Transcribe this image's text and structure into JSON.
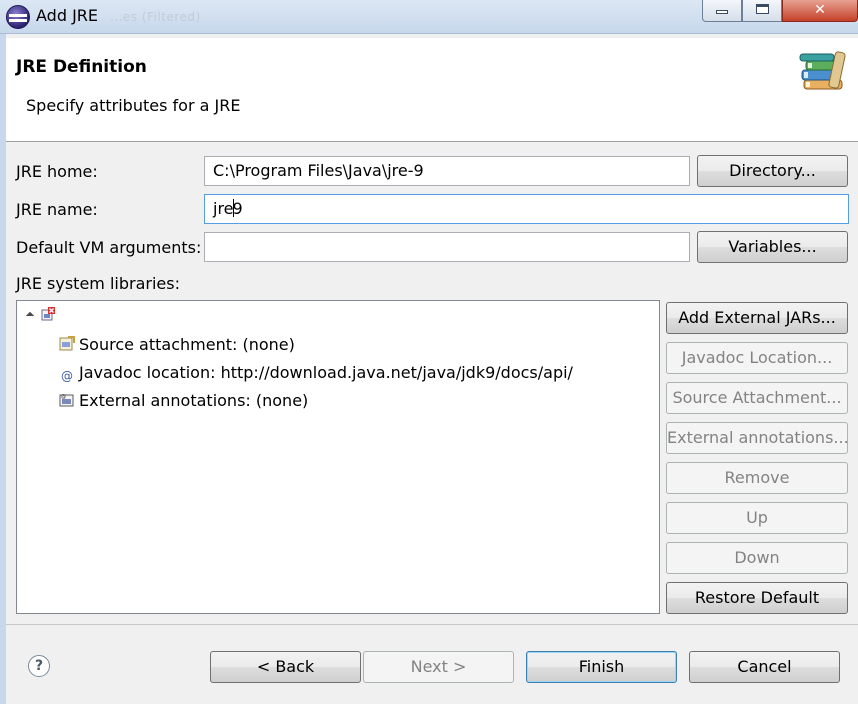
{
  "window": {
    "title": "Add JRE",
    "ghost_title": "...es (Filtered)"
  },
  "header": {
    "title": "JRE Definition",
    "description": "Specify attributes for a JRE",
    "icon": "library-books-icon"
  },
  "form": {
    "jre_home_label": "JRE home:",
    "jre_home_value": "C:\\Program Files\\Java\\jre-9",
    "jre_name_label": "JRE name:",
    "jre_name_before_caret": "jre",
    "jre_name_after_caret": "9",
    "vm_args_label": "Default VM arguments:",
    "vm_args_value": "",
    "directory_button": "Directory...",
    "variables_button": "Variables...",
    "libraries_label": "JRE system libraries:"
  },
  "tree": {
    "root_icon": "jar-error-icon",
    "children": [
      {
        "icon": "source-attachment-icon",
        "label": "Source attachment: (none)"
      },
      {
        "icon": "javadoc-icon",
        "label": "Javadoc location: http://download.java.net/java/jdk9/docs/api/"
      },
      {
        "icon": "external-annotations-icon",
        "label": "External annotations: (none)"
      }
    ]
  },
  "side_buttons": [
    {
      "label": "Add External JARs...",
      "enabled": true
    },
    {
      "label": "Javadoc Location...",
      "enabled": false
    },
    {
      "label": "Source Attachment...",
      "enabled": false
    },
    {
      "label": "External annotations...",
      "enabled": false
    },
    {
      "label": "Remove",
      "enabled": false
    },
    {
      "label": "Up",
      "enabled": false
    },
    {
      "label": "Down",
      "enabled": false
    },
    {
      "label": "Restore Default",
      "enabled": true
    }
  ],
  "footer": {
    "help_glyph": "?",
    "back": "< Back",
    "next": "Next >",
    "finish": "Finish",
    "cancel": "Cancel"
  }
}
